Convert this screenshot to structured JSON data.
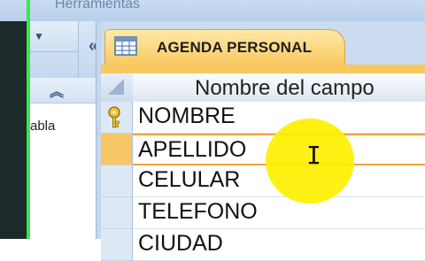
{
  "ribbon": {
    "tab_label": "Herramientas"
  },
  "nav_pane": {
    "collapse_icon": "«",
    "dropdown_icon": "chevron-down-icon",
    "group_toggle_icon": "double-chevron-up-icon",
    "item_text": "abla"
  },
  "document_tab": {
    "label": "AGENDA PERSONAL",
    "icon": "table-icon"
  },
  "grid": {
    "column_header": "Nombre del campo",
    "rows": [
      {
        "value": "NOMBRE",
        "primary_key": true
      },
      {
        "value": "APELLIDO",
        "active": true
      },
      {
        "value": "CELULAR"
      },
      {
        "value": "TELEFONO"
      },
      {
        "value": "CIUDAD"
      }
    ]
  },
  "colors": {
    "active_tab": "#f9c860",
    "cursor_highlight": "#fff000",
    "accent_line": "#39e84a"
  }
}
